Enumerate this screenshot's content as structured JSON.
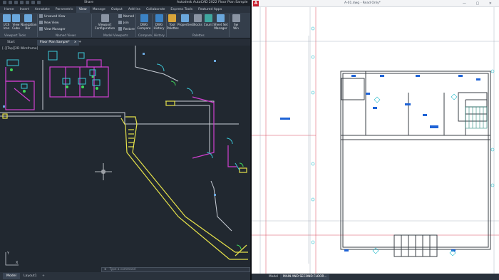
{
  "left_window": {
    "title": "Autodesk AutoCAD 2022   Floor Plan Sample",
    "share": "Share",
    "ribbon_tabs": [
      "Home",
      "Insert",
      "Annotate",
      "Parametric",
      "View",
      "Manage",
      "Output",
      "Add-ins",
      "Collaborate",
      "Express Tools",
      "Featured Apps"
    ],
    "active_tab": "View",
    "ribbon": {
      "ucs_icon": "UCS Icon",
      "view_cube": "View Cube",
      "navigation_bar": "Navigation Bar",
      "unsaved_view": "Unsaved View",
      "new_view": "New View",
      "view_manager": "View Manager",
      "viewport_configuration": "Viewport Configuration",
      "named": "Named",
      "join": "Join",
      "restore": "Restore",
      "dwg_compare": "DWG Compare",
      "dwg_history": "DWG History",
      "tool_palettes": "Tool Palettes",
      "properties": "Properties",
      "blocks": "Blocks",
      "count": "Count",
      "sheet_set_manager": "Sheet Set Manager",
      "switch_windows": "Sw Win",
      "groups": {
        "viewport_tools": "Viewport Tools",
        "named_views": "Named Views",
        "model_viewports": "Model Viewports",
        "compare": "Compare",
        "history": "History",
        "palettes": "Palettes"
      }
    },
    "doc_tabs": {
      "start": "Start",
      "plan": "Floor Plan Sample*",
      "close": "×",
      "add": "+"
    },
    "viewport_label": "[–][Top][2D Wireframe]",
    "command_placeholder": "Type a command",
    "command_close": "×",
    "layout_tabs": [
      "Model",
      "Layout1",
      "+"
    ]
  },
  "right_window": {
    "title": "A-01.dwg - Read Only*",
    "window_controls": "—  ▢  ×",
    "logo": "A",
    "status_tabs": [
      "Model",
      "MAIN AND SECOND FLOOR..."
    ]
  },
  "colors": {
    "left_bg": "#212830",
    "ribbon_bg": "#343e4b",
    "right_bg": "#ffffff",
    "wall_cyan": "#3cc8d8",
    "wall_magenta": "#d13fd1",
    "wall_yellow": "#e6e24a",
    "wall_white": "#c9ced6",
    "door_green": "#3ed65a",
    "dim_blue": "#1f63d6",
    "grid_red": "#d8485a"
  }
}
